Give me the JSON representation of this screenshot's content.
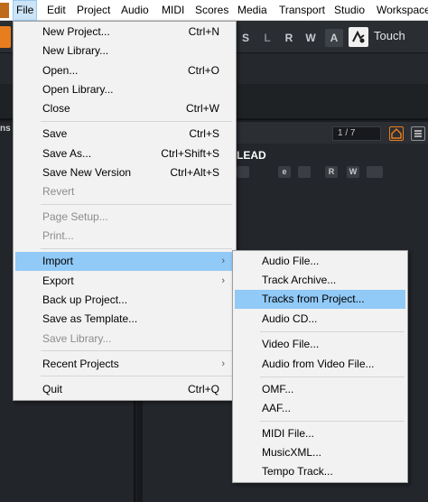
{
  "menubar": {
    "items": [
      "File",
      "Edit",
      "Project",
      "Audio",
      "MIDI",
      "Scores",
      "Media",
      "Transport",
      "Studio",
      "Workspace"
    ]
  },
  "toolbar": {
    "buttons": [
      "S",
      "L",
      "R",
      "W",
      "A"
    ],
    "touch_label": "Touch"
  },
  "left_panel": {
    "tab_fragment": "ns"
  },
  "track": {
    "counter": "1 / 7",
    "name": "LEAD",
    "controls": [
      "",
      "e",
      "",
      "R",
      "W",
      ""
    ]
  },
  "file_menu": {
    "new_project": {
      "label": "New Project...",
      "shortcut": "Ctrl+N"
    },
    "new_library": {
      "label": "New Library..."
    },
    "open": {
      "label": "Open...",
      "shortcut": "Ctrl+O"
    },
    "open_library": {
      "label": "Open Library..."
    },
    "close": {
      "label": "Close",
      "shortcut": "Ctrl+W"
    },
    "save": {
      "label": "Save",
      "shortcut": "Ctrl+S"
    },
    "save_as": {
      "label": "Save As...",
      "shortcut": "Ctrl+Shift+S"
    },
    "save_new_version": {
      "label": "Save New Version",
      "shortcut": "Ctrl+Alt+S"
    },
    "revert": {
      "label": "Revert"
    },
    "page_setup": {
      "label": "Page Setup..."
    },
    "print": {
      "label": "Print..."
    },
    "import": {
      "label": "Import"
    },
    "export": {
      "label": "Export"
    },
    "back_up_project": {
      "label": "Back up Project..."
    },
    "save_as_template": {
      "label": "Save as Template..."
    },
    "save_library": {
      "label": "Save Library..."
    },
    "recent_projects": {
      "label": "Recent Projects"
    },
    "quit": {
      "label": "Quit",
      "shortcut": "Ctrl+Q"
    }
  },
  "import_menu": {
    "audio_file": "Audio File...",
    "track_archive": "Track Archive...",
    "tracks_from_project": "Tracks from Project...",
    "audio_cd": "Audio CD...",
    "video_file": "Video File...",
    "audio_from_video_file": "Audio from Video File...",
    "omf": "OMF...",
    "aaf": "AAF...",
    "midi_file": "MIDI File...",
    "musicxml": "MusicXML...",
    "tempo_track": "Tempo Track..."
  },
  "colors": {
    "menu_highlight": "#91c9f7",
    "active_menubar_item": "#cce4f7",
    "cubase_orange": "#e87d1e"
  }
}
